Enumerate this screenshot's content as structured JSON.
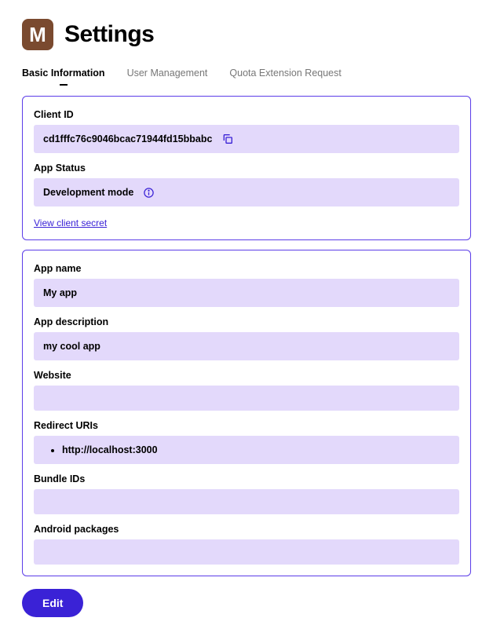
{
  "header": {
    "icon_letter": "M",
    "title": "Settings"
  },
  "tabs": {
    "basic": "Basic Information",
    "users": "User Management",
    "quota": "Quota Extension Request"
  },
  "panel1": {
    "client_id_label": "Client ID",
    "client_id_value": "cd1fffc76c9046bcac71944fd15bbabc",
    "app_status_label": "App Status",
    "app_status_value": "Development mode",
    "view_secret": "View client secret"
  },
  "panel2": {
    "app_name_label": "App name",
    "app_name_value": "My app",
    "app_desc_label": "App description",
    "app_desc_value": "my cool app",
    "website_label": "Website",
    "website_value": "",
    "redirect_label": "Redirect URIs",
    "redirect_uris": [
      "http://localhost:3000"
    ],
    "bundle_label": "Bundle IDs",
    "bundle_value": "",
    "android_label": "Android packages",
    "android_value": ""
  },
  "actions": {
    "edit": "Edit"
  }
}
